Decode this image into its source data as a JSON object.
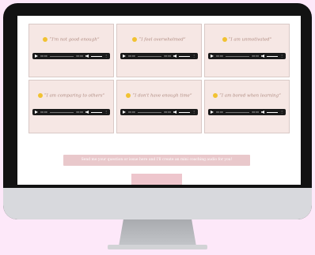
{
  "cards": [
    {
      "quote": "“I'm not good enough”",
      "emoji": "confused-face-icon"
    },
    {
      "quote": "“I feel overwhelmed”",
      "emoji": "weary-face-icon"
    },
    {
      "quote": "“I am unmotivated”",
      "emoji": "expressionless-face-icon"
    },
    {
      "quote": "“I am comparing to others”",
      "emoji": "thinking-face-icon"
    },
    {
      "quote": "“I don't have enough time”",
      "emoji": "sad-face-icon"
    },
    {
      "quote": "“I am bored when learning”",
      "emoji": "worried-face-icon"
    }
  ],
  "player": {
    "current_time": "00:00",
    "duration": "00:00"
  },
  "cta": {
    "label": "Send me your question or issue here and I'll create an mini coaching audio for you!"
  },
  "colors": {
    "card_bg": "#f6e7e4",
    "quote": "#b08c82",
    "cta_bg": "#e9c8cb",
    "backdrop": "#fde8f9"
  }
}
